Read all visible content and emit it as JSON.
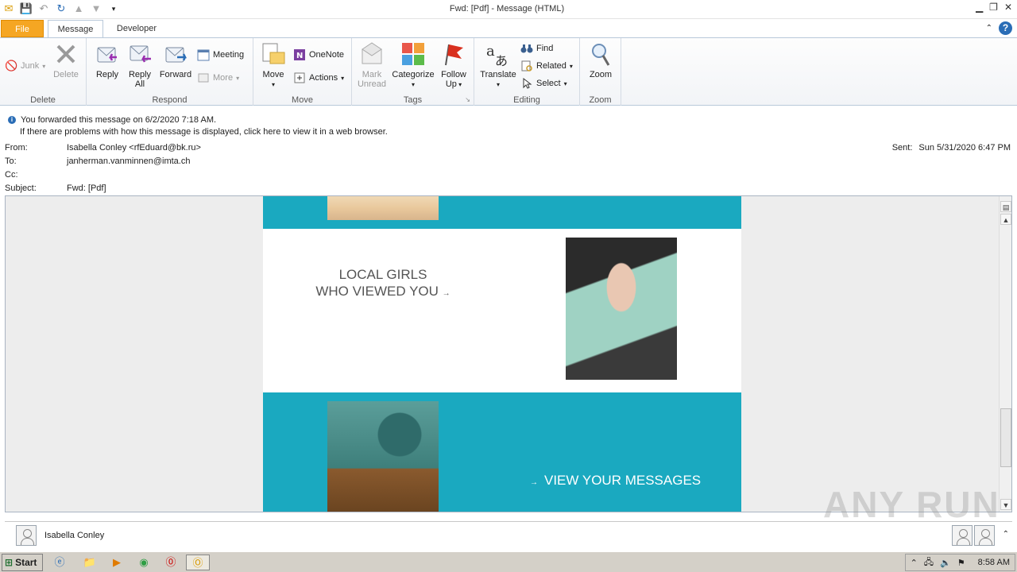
{
  "window": {
    "title": "Fwd: [Pdf]   -  Message (HTML)"
  },
  "tabs": [
    {
      "label": "File"
    },
    {
      "label": "Message"
    },
    {
      "label": "Developer"
    }
  ],
  "ribbon": {
    "groups": {
      "delete": {
        "label": "Delete",
        "junk": "Junk",
        "delete": "Delete"
      },
      "respond": {
        "label": "Respond",
        "reply": "Reply",
        "reply_all_1": "Reply",
        "reply_all_2": "All",
        "forward": "Forward",
        "meeting": "Meeting",
        "more": "More"
      },
      "move": {
        "label": "Move",
        "move": "Move",
        "onenote": "OneNote",
        "actions": "Actions"
      },
      "tags": {
        "label": "Tags",
        "mark_unread_1": "Mark",
        "mark_unread_2": "Unread",
        "categorize": "Categorize",
        "follow_up_1": "Follow",
        "follow_up_2": "Up"
      },
      "editing": {
        "label": "Editing",
        "translate": "Translate",
        "find": "Find",
        "related": "Related",
        "select": "Select"
      },
      "zoom": {
        "label": "Zoom",
        "zoom": "Zoom"
      }
    }
  },
  "infobar": {
    "line1": "You forwarded this message on 6/2/2020 7:18 AM.",
    "line2": "If there are problems with how this message is displayed, click here to view it in a web browser."
  },
  "headers": {
    "from_label": "From:",
    "from_value": "Isabella Conley <rfEduard@bk.ru>",
    "to_label": "To:",
    "to_value": "janherman.vanminnen@imta.ch",
    "cc_label": "Cc:",
    "cc_value": "",
    "subject_label": "Subject:",
    "subject_value": "Fwd: [Pdf]",
    "sent_label": "Sent:",
    "sent_value": "Sun 5/31/2020 6:47 PM"
  },
  "email": {
    "local_line1": "LOCAL GIRLS",
    "local_line2": "WHO VIEWED YOU",
    "view_messages": "VIEW YOUR MESSAGES",
    "accent_color": "#1aa9c0"
  },
  "people_pane": {
    "name": "Isabella Conley"
  },
  "taskbar": {
    "start": "Start",
    "clock": "8:58 AM"
  },
  "watermark": "ANY RUN"
}
